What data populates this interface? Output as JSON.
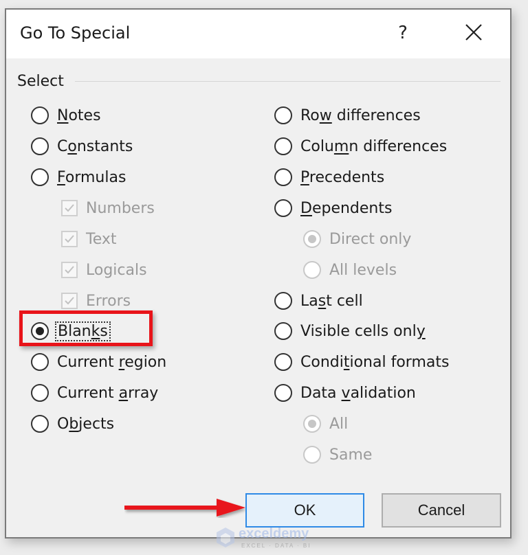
{
  "dialog": {
    "title": "Go To Special",
    "help_label": "?",
    "close_icon": "close-icon",
    "group_label": "Select"
  },
  "left_options": [
    {
      "pre": "",
      "u": "N",
      "post": "otes",
      "type": "radio",
      "checked": false,
      "disabled": false
    },
    {
      "pre": "C",
      "u": "o",
      "post": "nstants",
      "type": "radio",
      "checked": false,
      "disabled": false
    },
    {
      "pre": "",
      "u": "F",
      "post": "ormulas",
      "type": "radio",
      "checked": false,
      "disabled": false
    },
    {
      "pre": "Numbers",
      "u": "",
      "post": "",
      "type": "checkbox",
      "checked": true,
      "disabled": true
    },
    {
      "pre": "Text",
      "u": "",
      "post": "",
      "type": "checkbox",
      "checked": true,
      "disabled": true
    },
    {
      "pre": "Logicals",
      "u": "",
      "post": "",
      "type": "checkbox",
      "checked": true,
      "disabled": true
    },
    {
      "pre": "Errors",
      "u": "",
      "post": "",
      "type": "checkbox",
      "checked": true,
      "disabled": true
    },
    {
      "pre": "Blan",
      "u": "k",
      "post": "s",
      "type": "radio",
      "checked": true,
      "disabled": false
    },
    {
      "pre": "Current ",
      "u": "r",
      "post": "egion",
      "type": "radio",
      "checked": false,
      "disabled": false
    },
    {
      "pre": "Current ",
      "u": "a",
      "post": "rray",
      "type": "radio",
      "checked": false,
      "disabled": false
    },
    {
      "pre": "O",
      "u": "b",
      "post": "jects",
      "type": "radio",
      "checked": false,
      "disabled": false
    }
  ],
  "right_options": [
    {
      "pre": "Ro",
      "u": "w",
      "post": " differences",
      "type": "radio",
      "checked": false,
      "disabled": false
    },
    {
      "pre": "Colu",
      "u": "m",
      "post": "n differences",
      "type": "radio",
      "checked": false,
      "disabled": false
    },
    {
      "pre": "",
      "u": "P",
      "post": "recedents",
      "type": "radio",
      "checked": false,
      "disabled": false
    },
    {
      "pre": "",
      "u": "D",
      "post": "ependents",
      "type": "radio",
      "checked": false,
      "disabled": false
    },
    {
      "pre": "Direct only",
      "u": "",
      "post": "",
      "type": "radio",
      "checked": true,
      "disabled": true
    },
    {
      "pre": "All levels",
      "u": "",
      "post": "",
      "type": "radio",
      "checked": false,
      "disabled": true
    },
    {
      "pre": "La",
      "u": "s",
      "post": "t cell",
      "type": "radio",
      "checked": false,
      "disabled": false
    },
    {
      "pre": "Visible cells onl",
      "u": "y",
      "post": "",
      "type": "radio",
      "checked": false,
      "disabled": false
    },
    {
      "pre": "Condi",
      "u": "t",
      "post": "ional formats",
      "type": "radio",
      "checked": false,
      "disabled": false
    },
    {
      "pre": "Data ",
      "u": "v",
      "post": "alidation",
      "type": "radio",
      "checked": false,
      "disabled": false
    },
    {
      "pre": "All",
      "u": "",
      "post": "",
      "type": "radio",
      "checked": true,
      "disabled": true
    },
    {
      "pre": "Same",
      "u": "",
      "post": "",
      "type": "radio",
      "checked": false,
      "disabled": true
    }
  ],
  "buttons": {
    "ok_label": "OK",
    "cancel_label": "Cancel"
  },
  "annotation": {
    "highlight_color": "#e8141a",
    "arrow_color": "#e8141a"
  },
  "watermark": {
    "brand": "exceldemy",
    "tagline": "EXCEL · DATA · BI"
  }
}
